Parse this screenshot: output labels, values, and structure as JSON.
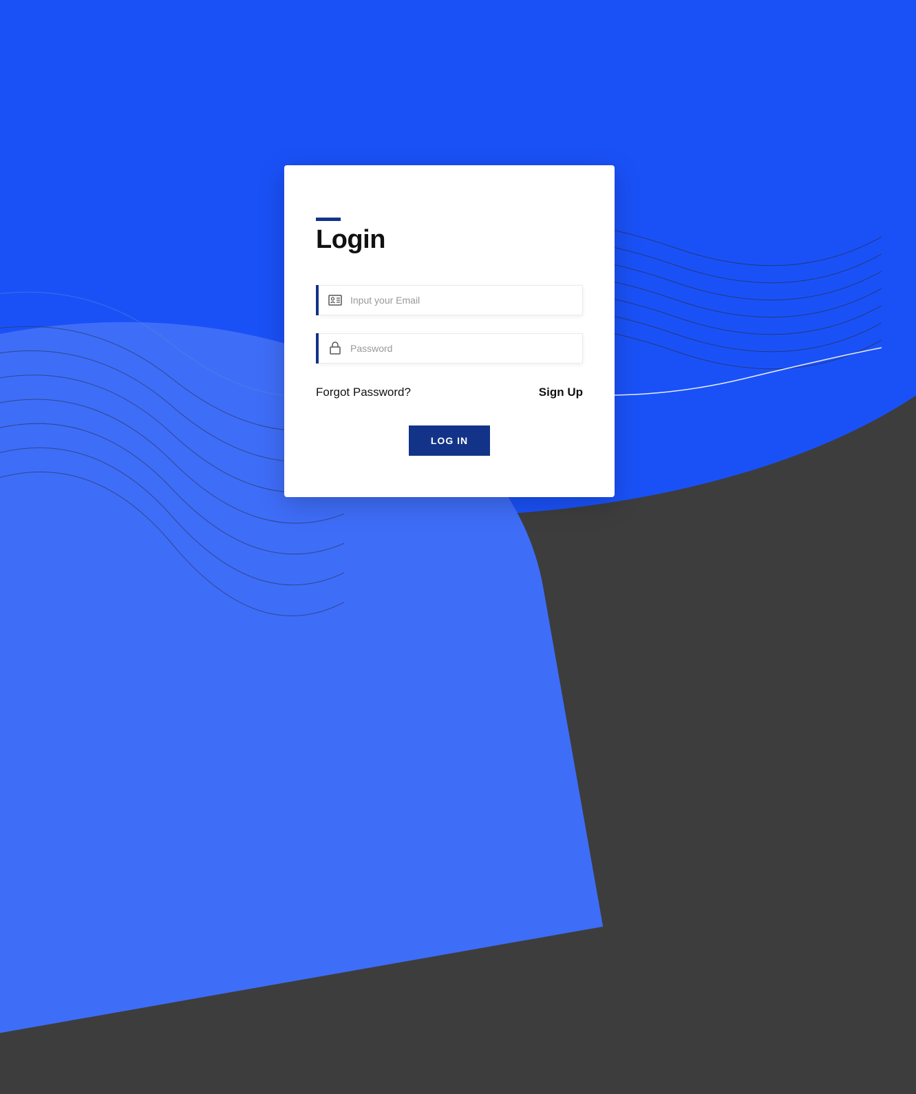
{
  "login": {
    "title": "Login",
    "email": {
      "placeholder": "Input your Email",
      "value": ""
    },
    "password": {
      "placeholder": "Password",
      "value": ""
    },
    "forgot_label": "Forgot Password?",
    "signup_label": "Sign Up",
    "button_label": "LOG IN"
  },
  "colors": {
    "accent": "#133388",
    "primary_blue": "#1a51f7",
    "light_blue": "#3e6df8",
    "dark_bg": "#3d3d3d"
  }
}
